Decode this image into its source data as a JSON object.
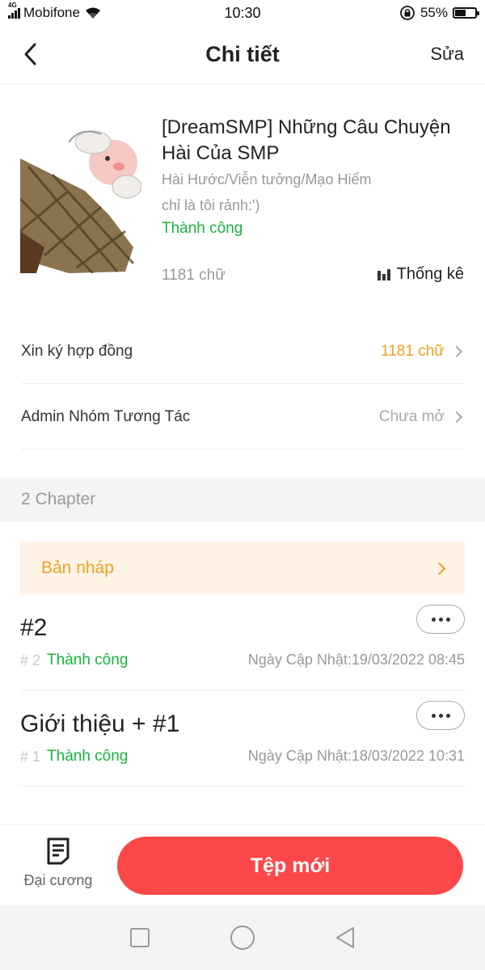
{
  "status_bar": {
    "carrier": "Mobifone",
    "network_badge": "4G",
    "time": "10:30",
    "battery": "55%",
    "battery_level": 0.55,
    "icons": [
      "signal-icon",
      "wifi-icon",
      "rotation-lock-icon",
      "battery-icon"
    ]
  },
  "header": {
    "title": "Chi tiết",
    "edit_label": "Sửa",
    "back_icon": "back-arrow-icon"
  },
  "book": {
    "title": "[DreamSMP] Những Câu Chuyện Hài Của SMP",
    "genres": "Hài Hước/Viễn tưởng/Mạo Hiểm",
    "description": "chỉ là tôi rảnh:')",
    "status": "Thành công",
    "word_count": "1181 chữ",
    "stats_label": "Thống kê"
  },
  "rows": [
    {
      "label": "Xin ký hợp đồng",
      "value": "1181 chữ",
      "value_color": "#f0a020"
    },
    {
      "label": "Admin Nhóm Tương Tác",
      "value": "Chưa mở",
      "value_color": "#aaaaaa"
    }
  ],
  "chapter_count": "2 Chapter",
  "draft": {
    "label": "Bản nháp"
  },
  "chapters": [
    {
      "title": "#2",
      "number": "# 2",
      "status": "Thành công",
      "updated": "Ngày Cập Nhật:19/03/2022 08:45"
    },
    {
      "title": "Giới thiệu + #1",
      "number": "# 1",
      "status": "Thành công",
      "updated": "Ngày Cập Nhật:18/03/2022 10:31"
    }
  ],
  "bottom": {
    "outline_label": "Đại cương",
    "new_file_label": "Tệp mới"
  },
  "colors": {
    "accent_red": "#fb4748",
    "success_green": "#17b53a",
    "orange": "#f0a020"
  }
}
